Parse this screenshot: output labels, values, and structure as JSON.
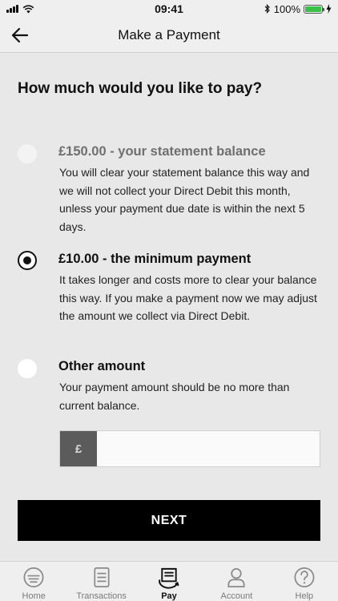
{
  "status_bar": {
    "time": "09:41",
    "battery": "100%"
  },
  "header": {
    "title": "Make a Payment"
  },
  "question": "How much would you like to pay?",
  "options": [
    {
      "title": "£150.00 - your statement balance",
      "description": "You will clear your statement balance this way and we will not collect your Direct Debit this month, unless your payment due date is within the next 5 days.",
      "state": "disabled"
    },
    {
      "title": "£10.00 - the minimum payment",
      "description": "It takes longer and costs more to clear your balance this way. If you make a payment now we may adjust the amount we collect via Direct Debit.",
      "state": "selected"
    },
    {
      "title": "Other amount",
      "description": "Your payment amount should be no more than current balance.",
      "state": "unselected"
    }
  ],
  "amount": {
    "currency_symbol": "£",
    "value": ""
  },
  "next_button": "NEXT",
  "tabs": [
    {
      "label": "Home",
      "icon": "home-icon",
      "active": false
    },
    {
      "label": "Transactions",
      "icon": "transactions-icon",
      "active": false
    },
    {
      "label": "Pay",
      "icon": "pay-icon",
      "active": true
    },
    {
      "label": "Account",
      "icon": "account-icon",
      "active": false
    },
    {
      "label": "Help",
      "icon": "help-icon",
      "active": false
    }
  ],
  "colors": {
    "background": "#e8e8e8",
    "button": "#000000",
    "battery": "#3ac14a",
    "currency_tag": "#5b5b5b"
  }
}
